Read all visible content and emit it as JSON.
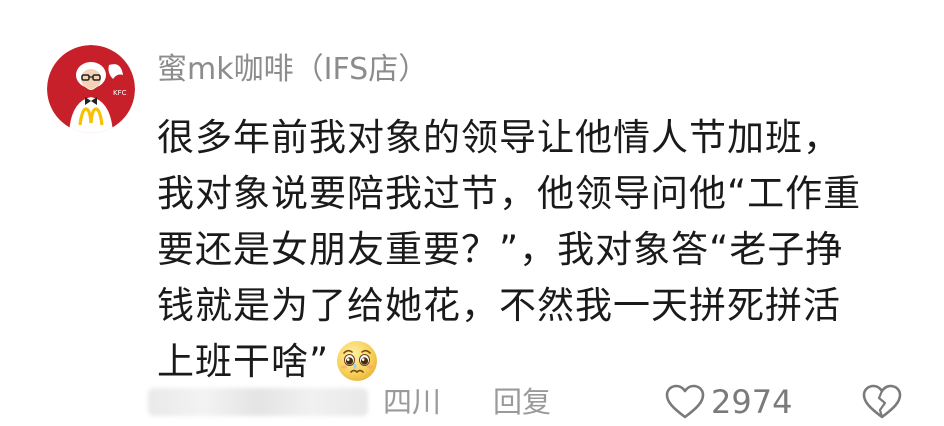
{
  "comment": {
    "username": "蜜mk咖啡（IFS店）",
    "avatar_icon": "kfc-mcdonalds-mascot-avatar",
    "text_lines": [
      "很多年前我对象的领导让他情人节加班，",
      "我对象说要陪我过节，他领导问他“工作重",
      "要还是女朋友重要？”，我对象答“老子挣",
      "钱就是为了给她花，不然我一天拼死拼活",
      "上班干啥”"
    ],
    "emoji_icon": "pleading-face-emoji",
    "location": "四川",
    "reply_label": "回复",
    "like_count": "2974"
  },
  "colors": {
    "username": "#8c8c8c",
    "text": "#1a1a1a",
    "meta": "#9a9a9a",
    "avatar_red": "#c8202a"
  }
}
